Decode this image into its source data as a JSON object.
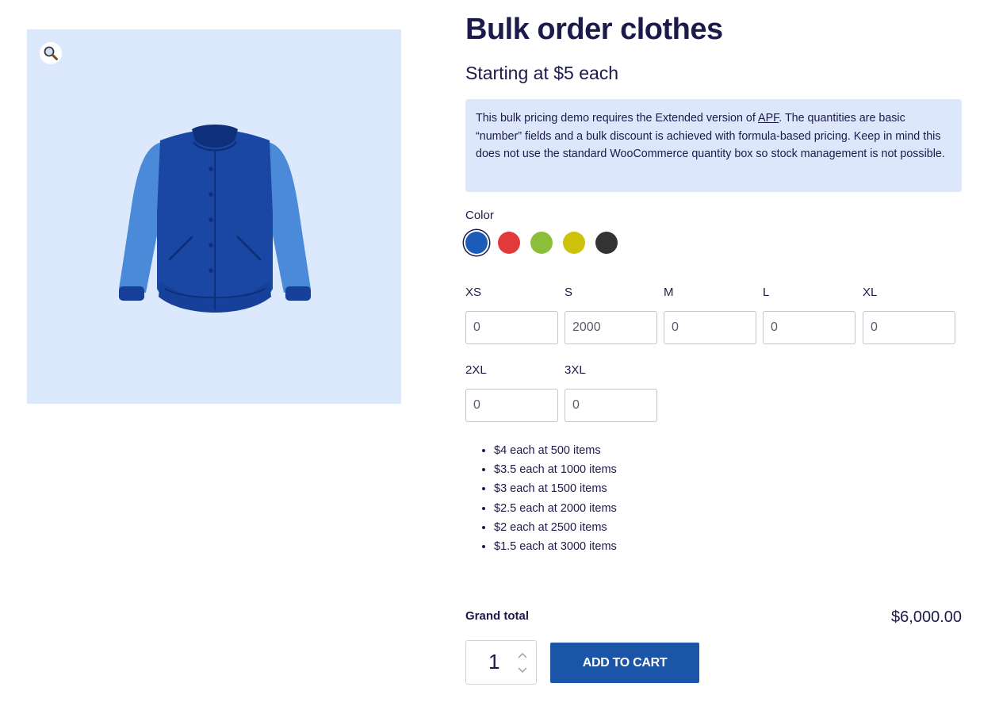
{
  "product": {
    "title": "Bulk order clothes",
    "price": "Starting at $5 each"
  },
  "gallery": {
    "zoom_icon": "magnifier-icon",
    "image": "blue-varsity-jacket"
  },
  "notice": {
    "before": "This bulk pricing demo requires the Extended version of ",
    "link_text": "APF",
    "after": ". The quantities are basic “number” fields and a bulk discount is achieved with formula-based pricing. Keep in mind this does not use the standard WooCommerce quantity box so stock management is not possible."
  },
  "color": {
    "label": "Color",
    "swatches": [
      {
        "name": "blue",
        "hex": "#1b5cb8",
        "selected": true
      },
      {
        "name": "red",
        "hex": "#e23a3a",
        "selected": false
      },
      {
        "name": "green",
        "hex": "#8bbf3a",
        "selected": false
      },
      {
        "name": "yellow",
        "hex": "#cdc10c",
        "selected": false
      },
      {
        "name": "black",
        "hex": "#333333",
        "selected": false
      }
    ]
  },
  "sizes": [
    {
      "label": "XS",
      "value": "0"
    },
    {
      "label": "S",
      "value": "2000"
    },
    {
      "label": "M",
      "value": "0"
    },
    {
      "label": "L",
      "value": "0"
    },
    {
      "label": "XL",
      "value": "0"
    },
    {
      "label": "2XL",
      "value": "0"
    },
    {
      "label": "3XL",
      "value": "0"
    }
  ],
  "tiers": [
    "$4 each at 500 items",
    "$3.5 each at 1000 items",
    "$3 each at 1500 items",
    "$2.5 each at 2000 items",
    "$2 each at 2500 items",
    "$1.5 each at 3000 items"
  ],
  "grand_total": {
    "label": "Grand total",
    "value": "$6,000.00"
  },
  "cart": {
    "quantity": "1",
    "button_label": "ADD TO CART"
  },
  "colors": {
    "text": "#1c1a4a",
    "accent": "#1b55a8",
    "gallery_bg": "#dce9fc",
    "notice_bg": "#dce7fb"
  }
}
